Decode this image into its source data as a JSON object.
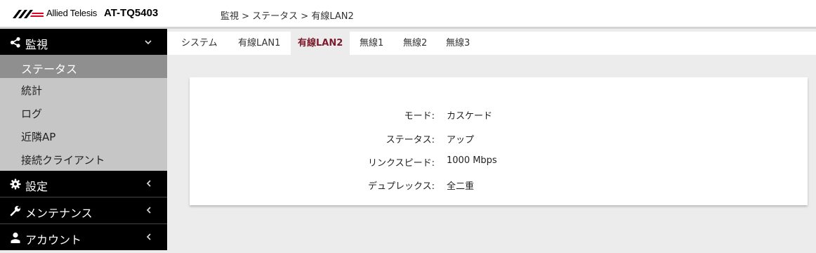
{
  "header": {
    "brand": "Allied Telesis",
    "model": "AT-TQ5403",
    "breadcrumb": "監視 > ステータス > 有線LAN2"
  },
  "sidebar": {
    "sections": [
      {
        "label": "監視",
        "icon": "share-icon",
        "state": "expanded"
      },
      {
        "label": "設定",
        "icon": "gear-icon",
        "state": "collapsed"
      },
      {
        "label": "メンテナンス",
        "icon": "wrench-icon",
        "state": "collapsed"
      },
      {
        "label": "アカウント",
        "icon": "user-icon",
        "state": "collapsed"
      }
    ],
    "monitor_items": [
      {
        "label": "ステータス",
        "active": true
      },
      {
        "label": "統計"
      },
      {
        "label": "ログ"
      },
      {
        "label": "近隣AP"
      },
      {
        "label": "接続クライアント"
      }
    ],
    "chevron_expanded": "⌄",
    "chevron_collapsed": "‹"
  },
  "tabs": [
    {
      "label": "システム"
    },
    {
      "label": "有線LAN1"
    },
    {
      "label": "有線LAN2",
      "active": true
    },
    {
      "label": "無線1"
    },
    {
      "label": "無線2"
    },
    {
      "label": "無線3"
    }
  ],
  "details": [
    {
      "key": "モード:",
      "value": "カスケード"
    },
    {
      "key": "ステータス:",
      "value": "アップ"
    },
    {
      "key": "リンクスピード:",
      "value": "1000 Mbps"
    },
    {
      "key": "デュプレックス:",
      "value": "全二重"
    }
  ],
  "colors": {
    "active_tab_text": "#7a1a2c",
    "sidebar_section_bg": "#000000",
    "sidebar_item_bg": "#c6c6c6",
    "sidebar_active_bg": "#8f8f8f",
    "logo_red": "#e2001a"
  }
}
